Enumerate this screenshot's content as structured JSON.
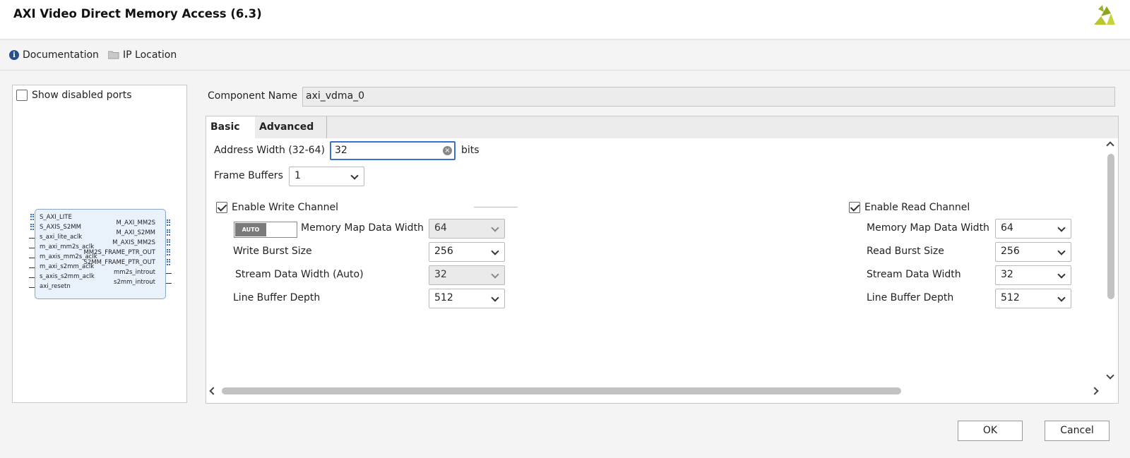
{
  "window": {
    "title": "AXI Video Direct Memory Access (6.3)",
    "logo_icon": "xilinx-logo-icon"
  },
  "toolbar": {
    "documentation": "Documentation",
    "ip_location": "IP Location"
  },
  "symbol_panel": {
    "show_disabled_ports": "Show disabled ports",
    "left_ports": [
      "S_AXI_LITE",
      "S_AXIS_S2MM",
      "s_axi_lite_aclk",
      "m_axi_mm2s_aclk",
      "m_axis_mm2s_aclk",
      "m_axi_s2mm_aclk",
      "s_axis_s2mm_aclk",
      "axi_resetn"
    ],
    "right_ports": [
      "M_AXI_MM2S",
      "M_AXI_S2MM",
      "M_AXIS_MM2S",
      "MM2S_FRAME_PTR_OUT",
      "S2MM_FRAME_PTR_OUT",
      "mm2s_introut",
      "s2mm_introut"
    ]
  },
  "component": {
    "label": "Component Name",
    "value": "axi_vdma_0"
  },
  "tabs": [
    {
      "label": "Basic"
    },
    {
      "label": "Advanced"
    }
  ],
  "basic": {
    "address_width_label": "Address Width (32-64)",
    "address_width_value": "32",
    "address_width_unit": "bits",
    "frame_buffers_label": "Frame Buffers",
    "frame_buffers_value": "1",
    "write": {
      "enable_label": "Enable Write Channel",
      "auto_label": "AUTO",
      "mm_data_width_label": "Memory Map Data Width",
      "mm_data_width_value": "64",
      "burst_size_label": "Write Burst Size",
      "burst_size_value": "256",
      "stream_width_label": "Stream Data Width (Auto)",
      "stream_width_value": "32",
      "line_buffer_label": "Line Buffer Depth",
      "line_buffer_value": "512"
    },
    "read": {
      "enable_label": "Enable Read Channel",
      "mm_data_width_label": "Memory Map Data Width",
      "mm_data_width_value": "64",
      "burst_size_label": "Read Burst Size",
      "burst_size_value": "256",
      "stream_width_label": "Stream Data Width",
      "stream_width_value": "32",
      "line_buffer_label": "Line Buffer Depth",
      "line_buffer_value": "512"
    }
  },
  "buttons": {
    "ok": "OK",
    "cancel": "Cancel"
  }
}
